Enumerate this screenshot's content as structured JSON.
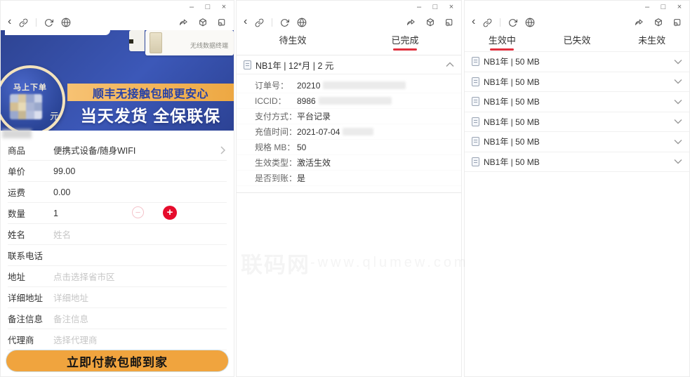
{
  "icons": {
    "back": "‹",
    "minimize": "–",
    "maximize": "□",
    "close": "×",
    "minus": "−",
    "plus": "+"
  },
  "colors": {
    "accent_red": "#e0303e",
    "banner_blue": "#31489c",
    "ribbon_gold": "#efa640",
    "button_gold": "#f0a43e",
    "plus_red": "#e60c2c"
  },
  "watermark": {
    "brand": "联码网",
    "suffix": "-www.qlumew.com"
  },
  "windows": {
    "left": {
      "banner": {
        "badge_action": "马上下单",
        "badge_unit": "元",
        "ribbon": "顺丰无接触包邮更安心",
        "headline": "当天发货 全保联保",
        "product_caption": "无线数据终端"
      },
      "form": {
        "rows": [
          {
            "label": "商品",
            "value": "便携式设备/随身WIFI"
          },
          {
            "label": "单价",
            "value": "99.00"
          },
          {
            "label": "运费",
            "value": "0.00"
          },
          {
            "label": "数量",
            "value": "1"
          },
          {
            "label": "姓名",
            "placeholder": "姓名"
          },
          {
            "label": "联系电话",
            "placeholder": ""
          },
          {
            "label": "地址",
            "placeholder": "点击选择省市区"
          },
          {
            "label": "详细地址",
            "placeholder": "详细地址"
          },
          {
            "label": "备注信息",
            "placeholder": "备注信息"
          },
          {
            "label": "代理商",
            "placeholder": "选择代理商"
          }
        ],
        "submit_label": "立即付款包邮到家"
      }
    },
    "middle": {
      "tabs": [
        {
          "label": "待生效"
        },
        {
          "label": "已完成"
        }
      ],
      "card": {
        "header": "NB1年 | 12*月 | 2 元",
        "details": [
          {
            "label": "订单号：",
            "value": "20210"
          },
          {
            "label": "ICCID：",
            "value": "8986"
          },
          {
            "label": "支付方式：",
            "value": "平台记录"
          },
          {
            "label": "充值时间：",
            "value": "2021-07-04"
          },
          {
            "label": "规格 MB：",
            "value": "50"
          },
          {
            "label": "生效类型：",
            "value": "激活生效"
          },
          {
            "label": "是否到账：",
            "value": "是"
          }
        ]
      }
    },
    "right": {
      "tabs": [
        {
          "label": "生效中"
        },
        {
          "label": "已失效"
        },
        {
          "label": "未生效"
        }
      ],
      "items": [
        "NB1年 | 50 MB",
        "NB1年 | 50 MB",
        "NB1年 | 50 MB",
        "NB1年 | 50 MB",
        "NB1年 | 50 MB",
        "NB1年 | 50 MB"
      ]
    }
  }
}
